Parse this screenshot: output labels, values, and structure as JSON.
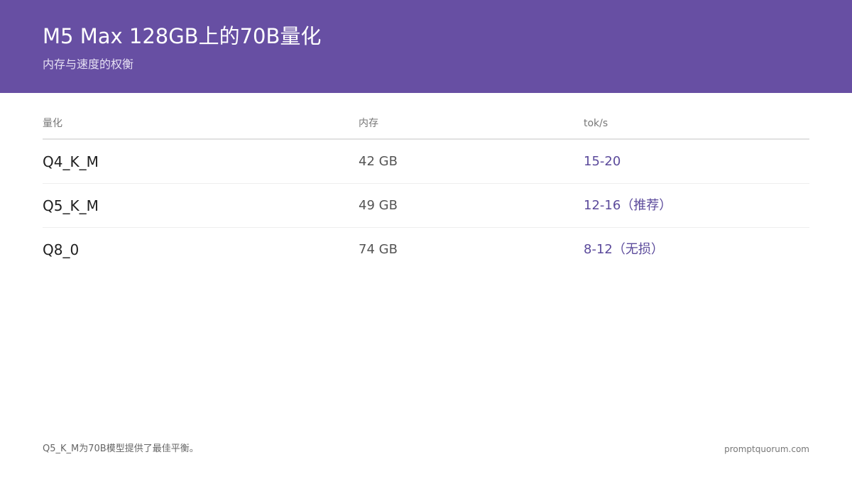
{
  "header": {
    "title": "M5 Max 128GB上的70B量化",
    "subtitle": "内存与速度的权衡"
  },
  "table": {
    "columns": [
      "量化",
      "内存",
      "tok/s"
    ],
    "rows": [
      [
        "Q4_K_M",
        "42 GB",
        "15-20"
      ],
      [
        "Q5_K_M",
        "49 GB",
        "12-16（推荐）"
      ],
      [
        "Q8_0",
        "74 GB",
        "8-12（无损）"
      ]
    ]
  },
  "footer": {
    "note": "Q5_K_M为70B模型提供了最佳平衡。",
    "brand": "promptquorum.com"
  },
  "colors": {
    "header_bg": "#674fa3",
    "accent_text": "#5b4a9b"
  }
}
